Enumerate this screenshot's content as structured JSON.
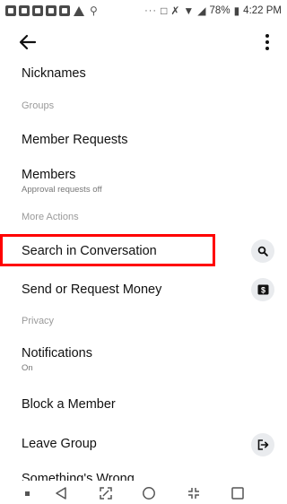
{
  "status_bar": {
    "battery": "78%",
    "time": "4:22 PM",
    "more": "···"
  },
  "app_bar": {
    "back_icon": "arrow-left-icon",
    "menu_icon": "more-vertical-icon"
  },
  "list": {
    "nicknames": "Nicknames",
    "section_groups": "Groups",
    "member_requests": "Member Requests",
    "members": "Members",
    "members_sub": "Approval requests off",
    "section_more_actions": "More Actions",
    "search_in_conversation": "Search in Conversation",
    "send_request_money": "Send or Request Money",
    "section_privacy": "Privacy",
    "notifications": "Notifications",
    "notifications_sub": "On",
    "block_member": "Block a Member",
    "leave_group": "Leave Group",
    "something_wrong": "Something's Wrong"
  },
  "icons": {
    "search": "search-icon",
    "money": "dollar-icon",
    "leave": "exit-icon"
  },
  "colors": {
    "highlight": "#ff0000",
    "icon_bg": "#e9ebee",
    "section_text": "#9a9a9a"
  }
}
